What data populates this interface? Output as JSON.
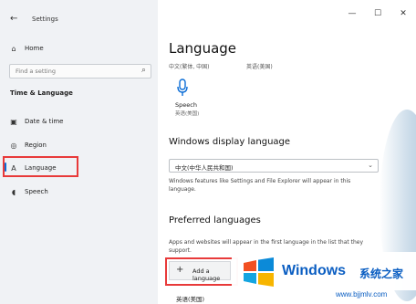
{
  "window": {
    "title": "Settings",
    "controls": [
      "—",
      "☐",
      "✕"
    ]
  },
  "sidebar": {
    "home": "Home",
    "search_placeholder": "Find a setting",
    "section": "Time & Language",
    "items": [
      {
        "label": "Date & time",
        "icon": "calendar-clock-icon"
      },
      {
        "label": "Region",
        "icon": "globe-icon"
      },
      {
        "label": "Language",
        "icon": "language-icon",
        "active": true
      },
      {
        "label": "Speech",
        "icon": "microphone-icon"
      }
    ]
  },
  "main": {
    "title": "Language",
    "lang_a": "中文(繁体, 中国)",
    "lang_b": "英语(美国)",
    "speech_title": "Speech",
    "speech_sub": "英语(美国)",
    "display_heading": "Windows display language",
    "display_value": "中文(中华人民共和国)",
    "display_note": "Windows features like Settings and File Explorer will appear in this language.",
    "preferred_heading": "Preferred languages",
    "preferred_note": "Apps and websites will appear in the first language in the list that they support.",
    "add_label": "Add a language",
    "first_lang": "英语(美国)"
  },
  "watermark": {
    "brand": "Windows",
    "cn": "系统之家",
    "url": "www.bjjmlv.com"
  },
  "colors": {
    "accent": "#0a6cd6",
    "highlight": "#e83a3a",
    "brand": "#0b5ec2"
  }
}
